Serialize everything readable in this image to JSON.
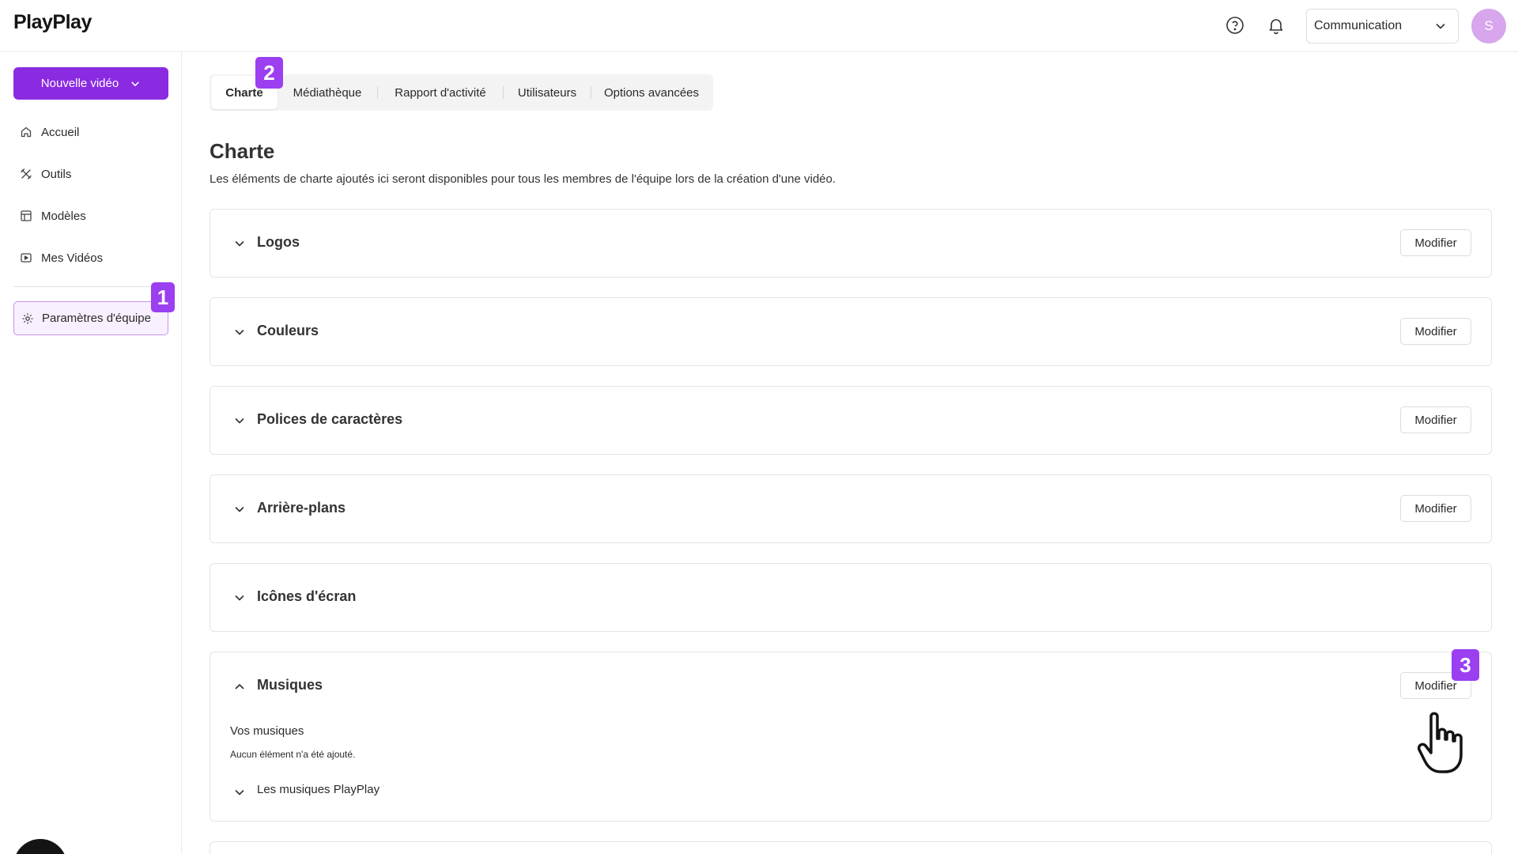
{
  "app": {
    "logo": "PlayPlay"
  },
  "header": {
    "help_icon": "question-circle-icon",
    "bell_icon": "bell-icon",
    "team_selector": {
      "value": "Communication"
    },
    "avatar_initial": "S",
    "accent_color": "#8a2be2"
  },
  "sidebar": {
    "new_video_label": "Nouvelle vidéo",
    "items": [
      {
        "label": "Accueil",
        "icon": "home-icon"
      },
      {
        "label": "Outils",
        "icon": "tools-icon"
      },
      {
        "label": "Modèles",
        "icon": "templates-icon"
      },
      {
        "label": "Mes Vidéos",
        "icon": "video-icon"
      }
    ],
    "team_settings": {
      "label": "Paramètres d'équipe",
      "icon": "gear-icon"
    }
  },
  "steps": [
    "1",
    "2",
    "3"
  ],
  "tabs": [
    {
      "label": "Charte",
      "active": true
    },
    {
      "label": "Médiathèque",
      "active": false
    },
    {
      "label": "Rapport d'activité",
      "active": false
    },
    {
      "label": "Utilisateurs",
      "active": false
    },
    {
      "label": "Options avancées",
      "active": false
    }
  ],
  "page": {
    "title": "Charte",
    "description": "Les éléments de charte ajoutés ici seront disponibles pour tous les membres de l'équipe lors de la création d'une vidéo."
  },
  "sections": [
    {
      "title": "Logos",
      "modify_label": "Modifier",
      "expanded": false
    },
    {
      "title": "Couleurs",
      "modify_label": "Modifier",
      "expanded": false
    },
    {
      "title": "Polices de caractères",
      "modify_label": "Modifier",
      "expanded": false
    },
    {
      "title": "Arrière-plans",
      "modify_label": "Modifier",
      "expanded": false
    },
    {
      "title": "Icônes d'écran",
      "expanded": false
    },
    {
      "title": "Musiques",
      "modify_label": "Modifier",
      "expanded": true,
      "your_music_heading": "Vos musiques",
      "your_music_empty": "Aucun élément n'a été ajouté.",
      "playplay_music_label": "Les musiques PlayPlay"
    }
  ]
}
